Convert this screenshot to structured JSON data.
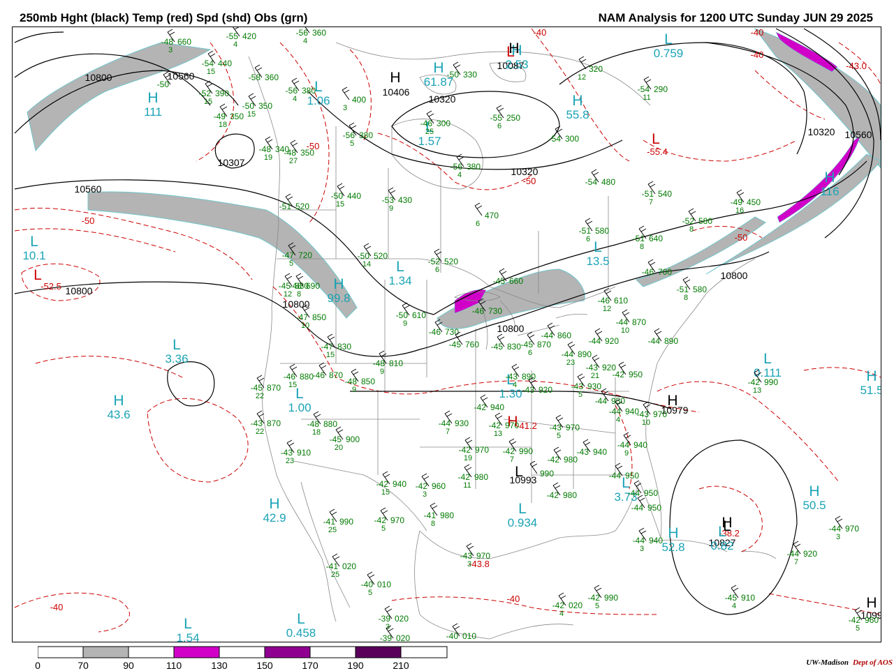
{
  "header": {
    "left_title": "250mb Hght (black) Temp (red) Spd (shd) Obs (grn)",
    "right_title": "NAM Analysis for 1200 UTC Sunday  JUN 29 2025"
  },
  "colors": {
    "height": "#000000",
    "temp": "#cc0000",
    "obs": "#007a00",
    "center_label": "#1aa3b5",
    "shade_70": "#b4b4b4",
    "shade_110": "#d000c8",
    "shade_150": "#900090",
    "shade_190": "#5a005a",
    "geography": "#888888"
  },
  "colorbar": {
    "labels": [
      "0",
      "70",
      "90",
      "110",
      "130",
      "150",
      "170",
      "190",
      "210"
    ]
  },
  "height_labels": [
    "10800",
    "10560",
    "10307",
    "10560",
    "10800",
    "10800",
    "10406",
    "10320",
    "10087",
    "10320",
    "10320",
    "10560",
    "10800",
    "10800",
    "10979",
    "10993",
    "10827",
    "1099"
  ],
  "temp_labels": [
    "-40",
    "-50",
    "-50",
    "-52.5",
    "-40",
    "-43.0",
    "-55.4",
    "-50",
    "-50",
    "-40",
    "-40",
    "-40",
    "-41.2",
    "-43.8",
    "-38.2"
  ],
  "centers": [
    {
      "type": "L",
      "value": "0.759",
      "c": "teal"
    },
    {
      "type": "H",
      "value": "111",
      "c": "teal"
    },
    {
      "type": "L",
      "value": "1.06",
      "c": "teal"
    },
    {
      "type": "H",
      "value": "61.87",
      "c": "teal"
    },
    {
      "type": "H",
      "value": "2.53",
      "c": "teal"
    },
    {
      "type": "L",
      "value": "1.57",
      "c": "teal"
    },
    {
      "type": "H",
      "value": "55.8",
      "c": "teal"
    },
    {
      "type": "H",
      "value": "116",
      "c": "teal"
    },
    {
      "type": "L",
      "value": "10.1",
      "c": "teal"
    },
    {
      "type": "L",
      "value": "1.34",
      "c": "teal"
    },
    {
      "type": "H",
      "value": "99.8",
      "c": "teal"
    },
    {
      "type": "L",
      "value": "13.5",
      "c": "teal"
    },
    {
      "type": "L",
      "value": "3.36",
      "c": "teal"
    },
    {
      "type": "H",
      "value": "43.6",
      "c": "teal"
    },
    {
      "type": "L",
      "value": "1.00",
      "c": "teal"
    },
    {
      "type": "L",
      "value": "1.30",
      "c": "teal"
    },
    {
      "type": "L",
      "value": "0.111",
      "c": "teal"
    },
    {
      "type": "H",
      "value": "51.5",
      "c": "teal"
    },
    {
      "type": "H",
      "value": "42.9",
      "c": "teal"
    },
    {
      "type": "L",
      "value": "0.934",
      "c": "teal"
    },
    {
      "type": "L",
      "value": "3.73",
      "c": "teal"
    },
    {
      "type": "H",
      "value": "50.5",
      "c": "teal"
    },
    {
      "type": "H",
      "value": "52.8",
      "c": "teal"
    },
    {
      "type": "L",
      "value": "0.82",
      "c": "teal"
    },
    {
      "type": "L",
      "value": "1.54",
      "c": "teal"
    },
    {
      "type": "L",
      "value": "0.458",
      "c": "teal"
    },
    {
      "type": "H",
      "value": "",
      "c": "black"
    },
    {
      "type": "H",
      "value": "",
      "c": "black"
    },
    {
      "type": "H",
      "value": "",
      "c": "black"
    },
    {
      "type": "H",
      "value": "",
      "c": "black"
    },
    {
      "type": "L",
      "value": "",
      "c": "black"
    },
    {
      "type": "H",
      "value": "",
      "c": "black"
    },
    {
      "type": "H",
      "value": "",
      "c": "red"
    },
    {
      "type": "L",
      "value": "",
      "c": "red"
    },
    {
      "type": "L",
      "value": "",
      "c": "red"
    },
    {
      "type": "L",
      "value": "",
      "c": "red"
    },
    {
      "type": "L",
      "value": "",
      "c": "black"
    }
  ],
  "obs": [
    {
      "t": "-48",
      "h": "660",
      "s": "3"
    },
    {
      "t": "-55",
      "h": "420",
      "s": "4"
    },
    {
      "t": "-56",
      "h": "360",
      "s": "4"
    },
    {
      "t": "-54",
      "h": "440",
      "s": "15"
    },
    {
      "t": "-50",
      "h": "",
      "s": ""
    },
    {
      "t": "-58",
      "h": "360",
      "s": ""
    },
    {
      "t": "-56",
      "h": "380",
      "s": "4"
    },
    {
      "t": "-52",
      "h": "390",
      "s": "15"
    },
    {
      "t": "-50",
      "h": "350",
      "s": "15"
    },
    {
      "t": "-49",
      "h": "350",
      "s": "18"
    },
    {
      "t": "-48",
      "h": "340",
      "s": "19"
    },
    {
      "t": "-48",
      "h": "350",
      "s": "27"
    },
    {
      "t": "",
      "h": "400",
      "s": "3"
    },
    {
      "t": "-56",
      "h": "380",
      "s": "5"
    },
    {
      "t": "-46",
      "h": "300",
      "s": "25"
    },
    {
      "t": "-50",
      "h": "330",
      "s": ""
    },
    {
      "t": "-55",
      "h": "250",
      "s": "6"
    },
    {
      "t": "-56",
      "h": "380",
      "s": "4"
    },
    {
      "t": "-54",
      "h": "300",
      "s": ""
    },
    {
      "t": "",
      "h": "320",
      "s": "12"
    },
    {
      "t": "-54",
      "h": "290",
      "s": "11"
    },
    {
      "t": "-54",
      "h": "480",
      "s": ""
    },
    {
      "t": "-51",
      "h": "540",
      "s": "7"
    },
    {
      "t": "-49",
      "h": "450",
      "s": "16"
    },
    {
      "t": "-52",
      "h": "580",
      "s": "8"
    },
    {
      "t": "-51",
      "h": "520",
      "s": ""
    },
    {
      "t": "-50",
      "h": "440",
      "s": "15"
    },
    {
      "t": "-53",
      "h": "430",
      "s": "9"
    },
    {
      "t": "",
      "h": "470",
      "s": "6"
    },
    {
      "t": "-51",
      "h": "580",
      "s": "6"
    },
    {
      "t": "-51",
      "h": "640",
      "s": "8"
    },
    {
      "t": "-51",
      "h": "580",
      "s": "8"
    },
    {
      "t": "-47",
      "h": "720",
      "s": "5"
    },
    {
      "t": "-50",
      "h": "520",
      "s": "14"
    },
    {
      "t": "-52",
      "h": "520",
      "s": "6"
    },
    {
      "t": "-46",
      "h": "700",
      "s": ""
    },
    {
      "t": "-45",
      "h": "830",
      "s": "12"
    },
    {
      "t": "-48",
      "h": "690",
      "s": "8"
    },
    {
      "t": "-45",
      "h": "660",
      "s": ""
    },
    {
      "t": "-46",
      "h": "610",
      "s": "12"
    },
    {
      "t": "-50",
      "h": "610",
      "s": "9"
    },
    {
      "t": "-47",
      "h": "850",
      "s": "10"
    },
    {
      "t": "-46",
      "h": "730",
      "s": ""
    },
    {
      "t": "-46",
      "h": "730",
      "s": ""
    },
    {
      "t": "-45",
      "h": "760",
      "s": ""
    },
    {
      "t": "-47",
      "h": "830",
      "s": "15"
    },
    {
      "t": "-45",
      "h": "830",
      "s": ""
    },
    {
      "t": "-45",
      "h": "870",
      "s": "6"
    },
    {
      "t": "-44",
      "h": "860",
      "s": ""
    },
    {
      "t": "-44",
      "h": "870",
      "s": "10"
    },
    {
      "t": "-44",
      "h": "890",
      "s": ""
    },
    {
      "t": "-44",
      "h": "920",
      "s": ""
    },
    {
      "t": "-44",
      "h": "890",
      "s": "23"
    },
    {
      "t": "-48",
      "h": "810",
      "s": "9"
    },
    {
      "t": "-46",
      "h": "880",
      "s": "15"
    },
    {
      "t": "-46",
      "h": "870",
      "s": ""
    },
    {
      "t": "-48",
      "h": "850",
      "s": "9"
    },
    {
      "t": "-45",
      "h": "870",
      "s": "22"
    },
    {
      "t": "-43",
      "h": "890",
      "s": "4"
    },
    {
      "t": "-43",
      "h": "920",
      "s": "21"
    },
    {
      "t": "-42",
      "h": "950",
      "s": ""
    },
    {
      "t": "-42",
      "h": "990",
      "s": "13"
    },
    {
      "t": "-43",
      "h": "920",
      "s": ""
    },
    {
      "t": "-43",
      "h": "930",
      "s": "5"
    },
    {
      "t": "-44",
      "h": "950",
      "s": ""
    },
    {
      "t": "-44",
      "h": "940",
      "s": "4"
    },
    {
      "t": "-43",
      "h": "970",
      "s": "10"
    },
    {
      "t": "-43",
      "h": "870",
      "s": "22"
    },
    {
      "t": "-48",
      "h": "880",
      "s": "18"
    },
    {
      "t": "-45",
      "h": "900",
      "s": "20"
    },
    {
      "t": "-42",
      "h": "940",
      "s": ""
    },
    {
      "t": "-44",
      "h": "930",
      "s": "7"
    },
    {
      "t": "-42",
      "h": "970",
      "s": "13"
    },
    {
      "t": "-43",
      "h": "970",
      "s": "5"
    },
    {
      "t": "-44",
      "h": "940",
      "s": "9"
    },
    {
      "t": "-43",
      "h": "910",
      "s": "23"
    },
    {
      "t": "-42",
      "h": "970",
      "s": "19"
    },
    {
      "t": "-42",
      "h": "990",
      "s": "7"
    },
    {
      "t": "-42",
      "h": "980",
      "s": ""
    },
    {
      "t": "-43",
      "h": "940",
      "s": ""
    },
    {
      "t": "-42",
      "h": "980",
      "s": "11"
    },
    {
      "t": "",
      "h": "990",
      "s": ""
    },
    {
      "t": "-44",
      "h": "950",
      "s": ""
    },
    {
      "t": "-42",
      "h": "940",
      "s": "15"
    },
    {
      "t": "-42",
      "h": "960",
      "s": "3"
    },
    {
      "t": "-42",
      "h": "980",
      "s": ""
    },
    {
      "t": "-44",
      "h": "950",
      "s": ""
    },
    {
      "t": "-44",
      "h": "950",
      "s": ""
    },
    {
      "t": "-41",
      "h": "990",
      "s": "25"
    },
    {
      "t": "-42",
      "h": "970",
      "s": "5"
    },
    {
      "t": "-41",
      "h": "980",
      "s": "8"
    },
    {
      "t": "-44",
      "h": "940",
      "s": "3"
    },
    {
      "t": "-44",
      "h": "970",
      "s": "3"
    },
    {
      "t": "-41",
      "h": "020",
      "s": "25"
    },
    {
      "t": "-43",
      "h": "970",
      "s": "3"
    },
    {
      "t": "-44",
      "h": "920",
      "s": "7"
    },
    {
      "t": "-40",
      "h": "010",
      "s": "5"
    },
    {
      "t": "-42",
      "h": "990",
      "s": "5"
    },
    {
      "t": "-45",
      "h": "910",
      "s": "4"
    },
    {
      "t": "-42",
      "h": "020",
      "s": "4"
    },
    {
      "t": "-39",
      "h": "020",
      "s": "3"
    },
    {
      "t": "-42",
      "h": "960",
      "s": "5"
    },
    {
      "t": "-39",
      "h": "020",
      "s": ""
    },
    {
      "t": "-40",
      "h": "010",
      "s": ""
    }
  ],
  "credit": {
    "org": "UW-Madison",
    "dept": "Dept of AOS"
  }
}
